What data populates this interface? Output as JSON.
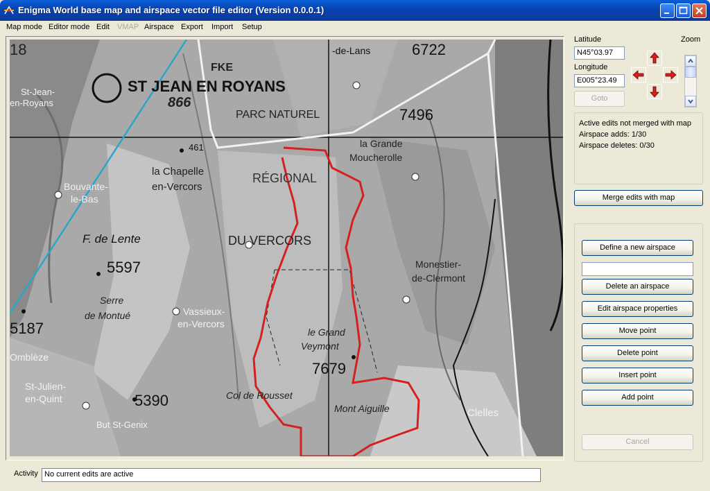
{
  "window": {
    "title": "Enigma World base map and airspace vector file editor (Version 0.0.0.1)",
    "icon": "enigma-app-icon",
    "controls": [
      "minimize",
      "maximize",
      "close"
    ]
  },
  "menu": {
    "items": [
      {
        "label": "Map mode",
        "enabled": true
      },
      {
        "label": "Editor mode",
        "enabled": true
      },
      {
        "label": "Edit",
        "enabled": true
      },
      {
        "label": "VMAP",
        "enabled": false
      },
      {
        "label": "Airspace",
        "enabled": true
      },
      {
        "label": "Export",
        "enabled": true
      },
      {
        "label": "Import",
        "enabled": true
      },
      {
        "label": "Setup",
        "enabled": true
      }
    ]
  },
  "map": {
    "place_labels": [
      "18",
      "-de-Lans",
      "6722",
      "FKE",
      "ST JEAN EN ROYANS",
      "866",
      "PARC NATUREL",
      "7496",
      "St-Jean-",
      "en-Royans",
      "461",
      "la Grande",
      "Moucherolle",
      "la Chapelle",
      "en-Vercors",
      "RÉGIONAL",
      "Bouvante-",
      "le-Bas",
      "F. de Lente",
      "DU VERCORS",
      "5597",
      "Monestier-",
      "de-Clermont",
      "Serre",
      "de Montué",
      "Vassieux-",
      "en-Vercors",
      "5187",
      "le Grand",
      "Veymont",
      "7679",
      "Omblèze",
      "St-Julien-",
      "en-Quint",
      "5390",
      "Col de Rousset",
      "Mont Aiguille",
      "But St-Genix",
      "Clelles"
    ]
  },
  "coords": {
    "latitude_label": "Latitude",
    "latitude_value": "N45°03.97",
    "longitude_label": "Longitude",
    "longitude_value": "E005°23.49",
    "goto_label": "Goto",
    "goto_enabled": false
  },
  "zoom": {
    "label": "Zoom"
  },
  "status": {
    "line1": "Active edits not merged with map",
    "line2": "Airspace adds: 1/30",
    "line3": "Airspace deletes: 0/30"
  },
  "merge_button": "Merge edits with map",
  "airspace_panel": {
    "define_button": "Define a new airspace",
    "name_value": "",
    "delete_airspace_button": "Delete an airspace",
    "edit_properties_button": "Edit airspace properties",
    "move_point_button": "Move point",
    "delete_point_button": "Delete point",
    "insert_point_button": "Insert point",
    "add_point_button": "Add point",
    "cancel_button": "Cancel",
    "cancel_enabled": false
  },
  "activity": {
    "label": "Activity",
    "value": "No current edits are active"
  },
  "colors": {
    "airspace_edit": "#d42020",
    "titlebar": "#0842b0",
    "window_bg": "#ece9d8"
  }
}
